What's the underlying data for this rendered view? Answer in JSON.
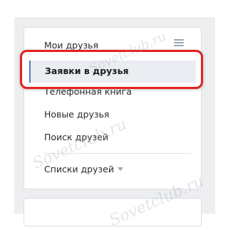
{
  "menu": {
    "items": [
      {
        "label": "Мои друзья",
        "state": "partially-covered"
      },
      {
        "label": "Заявки в друзья",
        "state": "active"
      },
      {
        "label": "Телефонная книга"
      },
      {
        "label": "Новые друзья"
      },
      {
        "label": "Поиск друзей"
      },
      {
        "label": "Списки друзей",
        "has_dropdown": true
      }
    ],
    "settings_icon": "settings-sliders-icon",
    "dropdown_icon": "caret-down-icon"
  },
  "highlight": {
    "color": "#e52020"
  },
  "watermark": {
    "text": "Sovetclub.ru"
  },
  "colors": {
    "accent": "#5181b8",
    "active_bg": "#eaedf1",
    "page_bg": "#edeef0"
  }
}
